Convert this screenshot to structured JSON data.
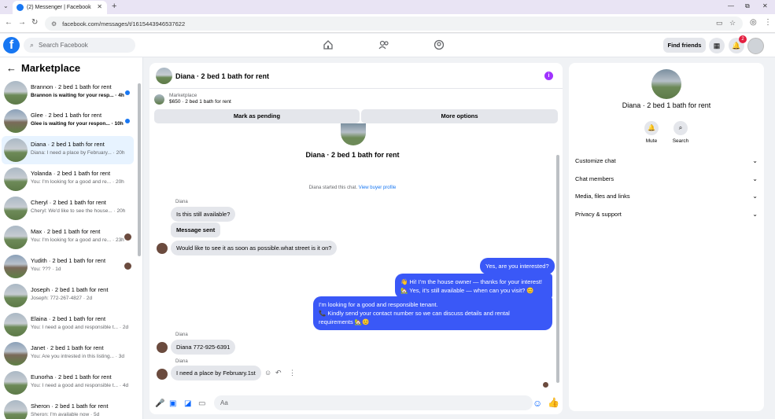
{
  "browser": {
    "tab_title": "(2) Messenger | Facebook",
    "tab_close": "✕",
    "new_tab": "+",
    "url": "facebook.com/messages/t/1615443946537622",
    "window_controls": [
      "—",
      "⧉",
      "✕"
    ]
  },
  "fb": {
    "logo": "f",
    "search_placeholder": "Search Facebook",
    "find_friends": "Find friends",
    "notification_count": "2"
  },
  "sidebar": {
    "title": "Marketplace",
    "back": "←",
    "chats": [
      {
        "name": "Brannon · 2 bed 1 bath for rent",
        "preview": "Brannon is waiting for your resp... · 4h",
        "unread": true
      },
      {
        "name": "Glee · 2 bed 1 bath for rent",
        "preview": "Glee is waiting for your respon... · 10h",
        "unread": true
      },
      {
        "name": "Diana · 2 bed 1 bath for rent",
        "preview": "Diana: I need a place by February... · 20h",
        "selected": true
      },
      {
        "name": "Yolanda · 2 bed 1 bath for rent",
        "preview": "You: I'm looking for a good and re... · 20h"
      },
      {
        "name": "Cheryl · 2 bed 1 bath for rent",
        "preview": "Cheryl: We'd like to see the house... · 20h"
      },
      {
        "name": "Max · 2 bed 1 bath for rent",
        "preview": "You: I'm looking for a good and re... · 23h",
        "seen": true
      },
      {
        "name": "Yudith · 2 bed 1 bath for rent",
        "preview": "You: ??? · 1d",
        "seen": true
      },
      {
        "name": "Joseph · 2 bed 1 bath for rent",
        "preview": "Joseph: 772-267-4827 · 2d"
      },
      {
        "name": "Elaina · 2 bed 1 bath for rent",
        "preview": "You: I need a good and responsible t... · 2d"
      },
      {
        "name": "Janet · 2 bed 1 bath for rent",
        "preview": "You: Are you intrested in this listing... · 3d"
      },
      {
        "name": "Eunorha · 2 bed 1 bath for rent",
        "preview": "You: I need a good and responsible t... · 4d"
      },
      {
        "name": "Sheron · 2 bed 1 bath for rent",
        "preview": "Sheron: I'm available now · 5d"
      }
    ]
  },
  "chat": {
    "header_name": "Diana · 2 bed 1 bath for rent",
    "info_icon": "i",
    "marketplace_label": "Marketplace",
    "listing": "$650 · 2 bed 1 bath for rent",
    "mark_pending": "Mark as pending",
    "more_options": "More options",
    "title": "Diana · 2 bed 1 bath for rent",
    "started_text": "Diana started this chat.",
    "view_profile": "View buyer profile",
    "sender_label": "Diana",
    "msg1": "Is this still available?",
    "msg2": "Message sent",
    "msg3": "Would like to see it as soon as possible.what street is it on?",
    "out1": "Yes, are you interested?",
    "out2a": "👋 Hi! I'm the house owner — thanks for your interest!",
    "out2b": "🏡 Yes, it's still available — when can you visit? 😊",
    "out3a": "I'm looking for a good and responsible tenant.",
    "out3b": "📞 Kindly send your contact number so we can discuss details and rental",
    "out3c": "requirements 🏡😊",
    "msg4": "Diana 772-925-6391",
    "msg5": "I need a place by February.1st",
    "input_placeholder": "Aa"
  },
  "details": {
    "name": "Diana · 2 bed 1 bath for rent",
    "mute": "Mute",
    "search": "Search",
    "sections": [
      "Customize chat",
      "Chat members",
      "Media, files and links",
      "Privacy & support"
    ]
  }
}
